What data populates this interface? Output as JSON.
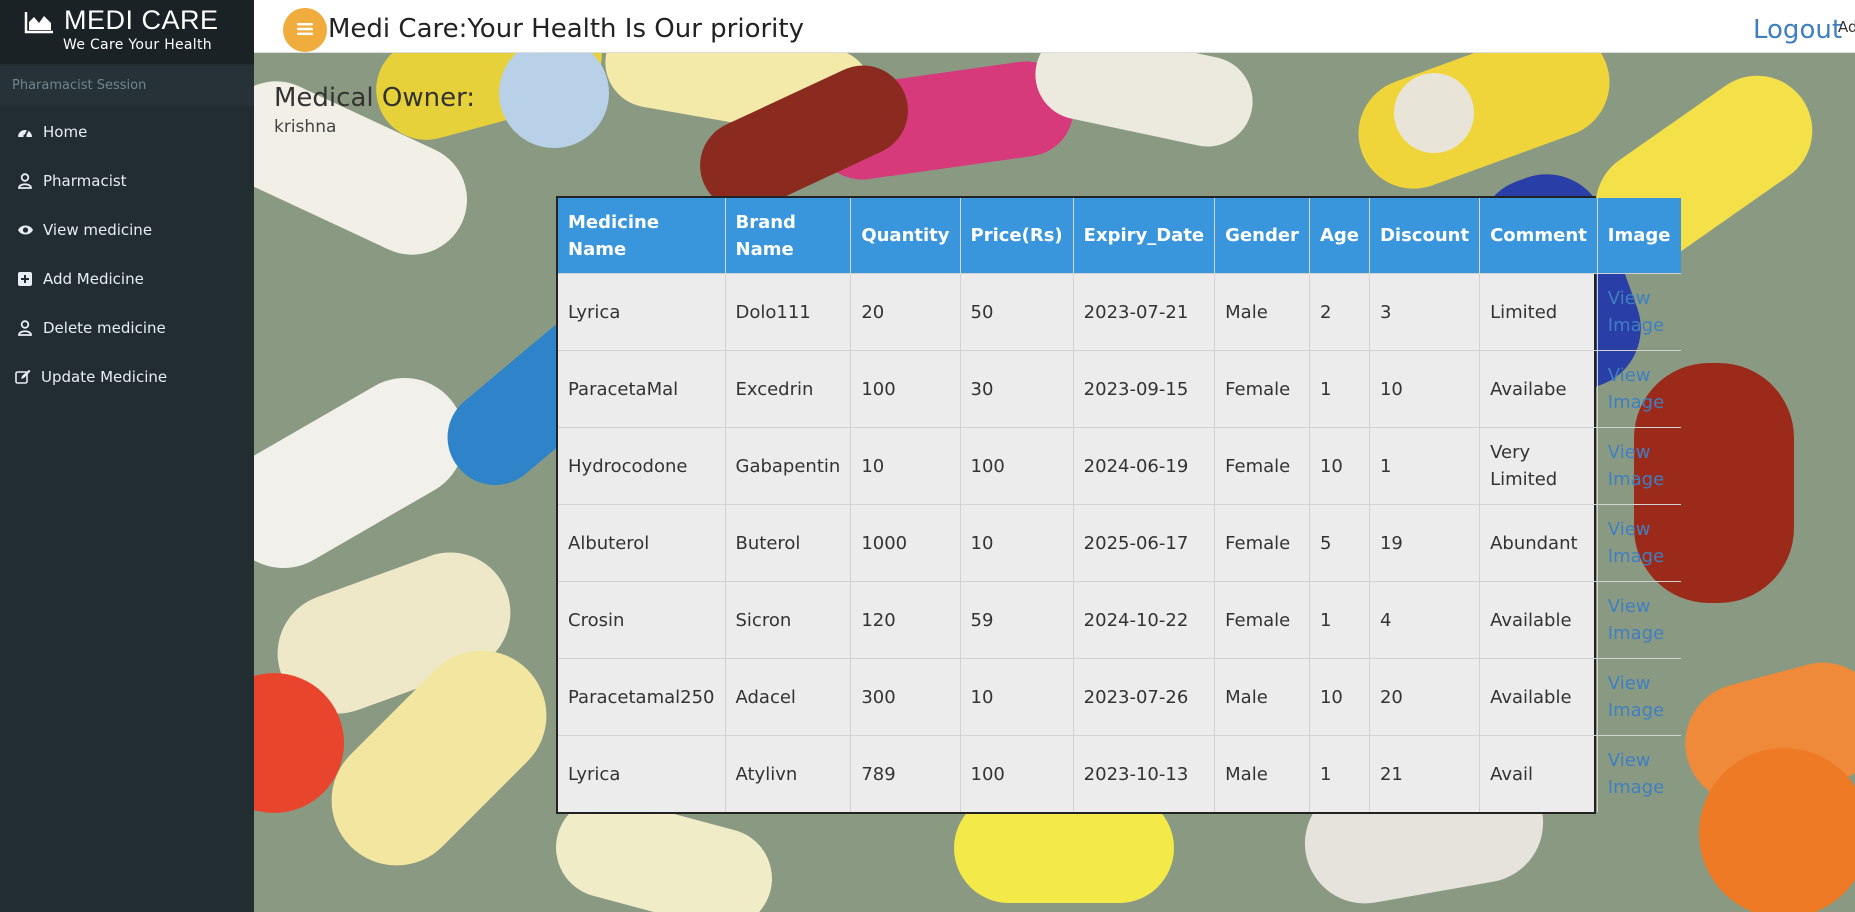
{
  "brand": {
    "name": "MEDI CARE",
    "tagline": "We Care Your Health",
    "logo_icon": "area-chart-icon"
  },
  "sidebar": {
    "session_label": "Pharamacist Session",
    "items": [
      {
        "label": "Home",
        "icon": "dashboard-icon"
      },
      {
        "label": "Pharmacist",
        "icon": "user-icon"
      },
      {
        "label": "View medicine",
        "icon": "eye-icon"
      },
      {
        "label": "Add Medicine",
        "icon": "plus-square-icon"
      },
      {
        "label": "Delete medicine",
        "icon": "user-icon"
      },
      {
        "label": "Update Medicine",
        "icon": "edit-icon"
      }
    ]
  },
  "header": {
    "title": "Medi Care:Your Health Is Our priority",
    "logout_label": "Logout",
    "admin_label": "Ad",
    "menu_icon": "hamburger-icon"
  },
  "owner": {
    "title": "Medical Owner:",
    "name": "krishna"
  },
  "table": {
    "columns": [
      "Medicine Name",
      "Brand Name",
      "Quantity",
      "Price(Rs)",
      "Expiry_Date",
      "Gender",
      "Age",
      "Discount",
      "Comment",
      "Image"
    ],
    "link_label": "View Image",
    "rows": [
      [
        "Lyrica",
        "Dolo111",
        "20",
        "50",
        "2023-07-21",
        "Male",
        "2",
        "3",
        "Limited"
      ],
      [
        "ParacetaMal",
        "Excedrin",
        "100",
        "30",
        "2023-09-15",
        "Female",
        "1",
        "10",
        "Availabe"
      ],
      [
        "Hydrocodone",
        "Gabapentin",
        "10",
        "100",
        "2024-06-19",
        "Female",
        "10",
        "1",
        "Very Limited"
      ],
      [
        "Albuterol",
        "Buterol",
        "1000",
        "10",
        "2025-06-17",
        "Female",
        "5",
        "19",
        "Abundant"
      ],
      [
        "Crosin",
        "Sicron",
        "120",
        "59",
        "2024-10-22",
        "Female",
        "1",
        "4",
        "Available"
      ],
      [
        "Paracetamal250",
        "Adacel",
        "300",
        "10",
        "2023-07-26",
        "Male",
        "10",
        "20",
        "Available"
      ],
      [
        "Lyrica",
        "Atylivn",
        "789",
        "100",
        "2023-10-13",
        "Male",
        "1",
        "21",
        "Avail"
      ]
    ]
  },
  "colors": {
    "sidebar_bg": "#222d32",
    "header_accent": "#f0ad3e",
    "table_header": "#3a96dc",
    "link": "#3f7fc1"
  }
}
